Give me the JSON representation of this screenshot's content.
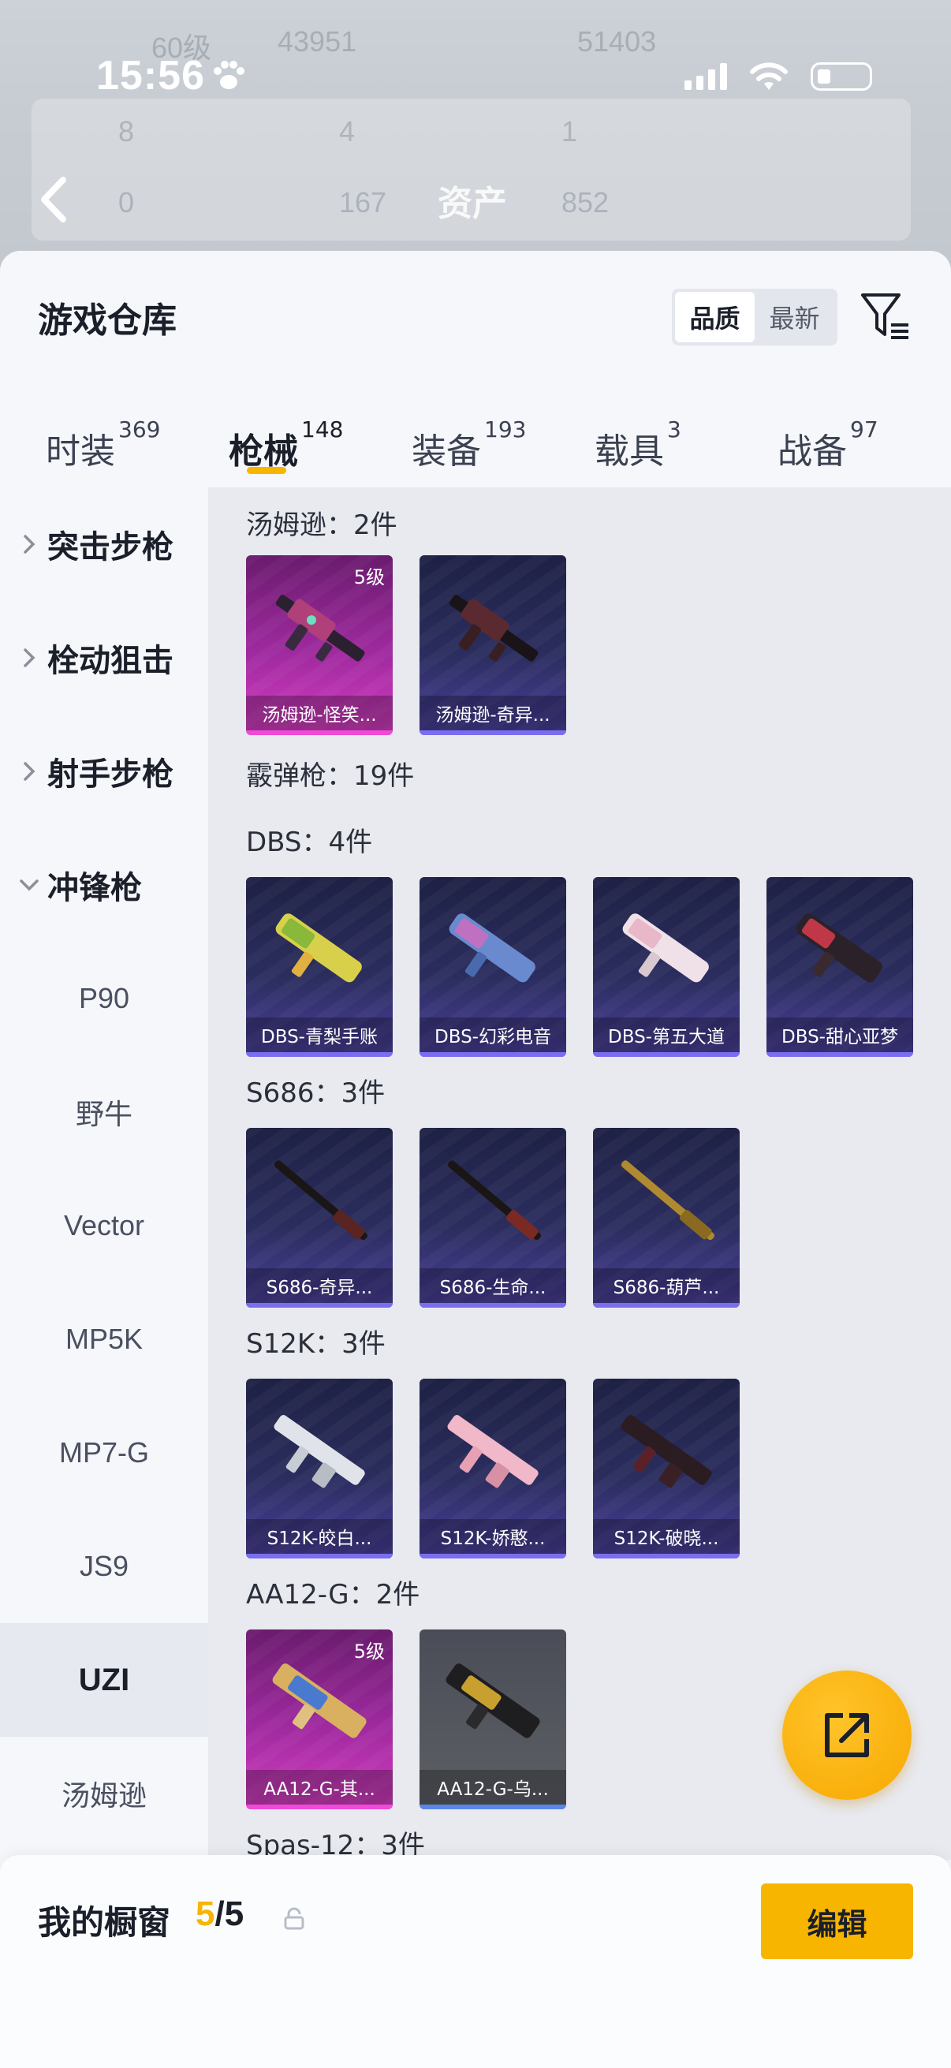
{
  "status_bar": {
    "time": "15:56"
  },
  "background": {
    "title": "资产",
    "stats_row1": [
      "60级",
      "43951",
      "51403"
    ],
    "stats_row2": [
      "8",
      "4",
      "1"
    ],
    "stats_row3": [
      "0",
      "167",
      "852"
    ]
  },
  "warehouse": {
    "title": "游戏仓库",
    "sort_options": [
      "品质",
      "最新"
    ],
    "active_sort": "品质",
    "tabs": [
      {
        "label": "时装",
        "count": "369"
      },
      {
        "label": "枪械",
        "count": "148"
      },
      {
        "label": "装备",
        "count": "193"
      },
      {
        "label": "载具",
        "count": "3"
      },
      {
        "label": "战备",
        "count": "97"
      }
    ],
    "active_tab": "枪械"
  },
  "categories": [
    {
      "label": "突击步枪",
      "expanded": false
    },
    {
      "label": "栓动狙击",
      "expanded": false
    },
    {
      "label": "射手步枪",
      "expanded": false
    },
    {
      "label": "冲锋枪",
      "expanded": true
    }
  ],
  "subcategories": [
    "P90",
    "野牛",
    "Vector",
    "MP5K",
    "MP7-G",
    "JS9",
    "UZI",
    "汤姆逊"
  ],
  "active_subcategory": "UZI",
  "groups": [
    {
      "title": "汤姆逊：2件",
      "items": [
        {
          "name": "汤姆逊-怪笑...",
          "level": "5级",
          "style": "pink"
        },
        {
          "name": "汤姆逊-奇异...",
          "level": "",
          "style": "purple"
        }
      ]
    },
    {
      "title": "霰弹枪：19件",
      "items": []
    },
    {
      "title": "DBS：4件",
      "items": [
        {
          "name": "DBS-青梨手账",
          "level": "",
          "style": "purple"
        },
        {
          "name": "DBS-幻彩电音",
          "level": "",
          "style": "purple"
        },
        {
          "name": "DBS-第五大道",
          "level": "",
          "style": "purple"
        },
        {
          "name": "DBS-甜心亚梦",
          "level": "",
          "style": "purple"
        }
      ]
    },
    {
      "title": "S686：3件",
      "items": [
        {
          "name": "S686-奇异...",
          "level": "",
          "style": "purple"
        },
        {
          "name": "S686-生命...",
          "level": "",
          "style": "purple"
        },
        {
          "name": "S686-葫芦...",
          "level": "",
          "style": "purple"
        }
      ]
    },
    {
      "title": "S12K：3件",
      "items": [
        {
          "name": "S12K-皎白...",
          "level": "",
          "style": "purple"
        },
        {
          "name": "S12K-娇憨...",
          "level": "",
          "style": "purple"
        },
        {
          "name": "S12K-破晓...",
          "level": "",
          "style": "purple"
        }
      ]
    },
    {
      "title": "AA12-G：2件",
      "items": [
        {
          "name": "AA12-G-其...",
          "level": "5级",
          "style": "pink"
        },
        {
          "name": "AA12-G-乌...",
          "level": "",
          "style": "grey"
        }
      ]
    },
    {
      "title": "Spas-12：3件",
      "items": []
    }
  ],
  "showcase": {
    "label": "我的橱窗",
    "current": "5",
    "separator": "/",
    "max": "5",
    "edit_label": "编辑"
  },
  "colors": {
    "accent": "#f7b500",
    "pink_card": "#d43cc0",
    "purple_card": "#4a3f9c"
  }
}
